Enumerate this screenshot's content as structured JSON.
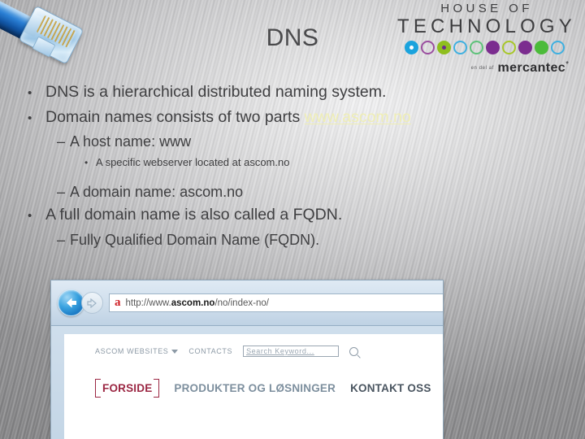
{
  "slide": {
    "title": "DNS",
    "bullets": [
      {
        "level": 1,
        "marker": "•",
        "text": "DNS is a hierarchical distributed naming system."
      },
      {
        "level": 1,
        "marker": "•",
        "text": "Domain names consists of two parts ",
        "link": "www.ascom.no"
      },
      {
        "level": 2,
        "marker": "–",
        "text": "A host name: www"
      },
      {
        "level": 3,
        "marker": "•",
        "text": "A specific webserver located at ascom.no"
      },
      {
        "level": 2,
        "marker": "–",
        "text": "A domain name: ascom.no"
      },
      {
        "level": 1,
        "marker": "•",
        "text": "A full domain name is also called a FQDN."
      },
      {
        "level": 2,
        "marker": "–",
        "text": "Fully Qualified Domain Name (FQDN)."
      }
    ]
  },
  "logo": {
    "line1": "HOUSE OF",
    "line2": "TECHNOLOGY",
    "tagline_prefix": "en del af",
    "tagline_brand": "mercantec",
    "tagline_star": "*",
    "dots": [
      {
        "fill": "#1aa3dd",
        "ring": "#1aa3dd",
        "center": true
      },
      {
        "fill": "none",
        "ring": "#9b4fa0",
        "center": false
      },
      {
        "fill": "#8fbe1f",
        "ring": "#8fbe1f",
        "center": true,
        "inner": "#6b2d8f"
      },
      {
        "fill": "none",
        "ring": "#3fb0e0",
        "center": true,
        "inner": "#8fbe1f"
      },
      {
        "fill": "none",
        "ring": "#5ec27a",
        "center": false
      },
      {
        "fill": "#7b2d8f",
        "ring": "#7b2d8f",
        "center": false
      },
      {
        "fill": "none",
        "ring": "#a8c72a",
        "center": true,
        "inner": "#7b2d8f"
      },
      {
        "fill": "#7b2d8f",
        "ring": "#7b2d8f",
        "center": false
      },
      {
        "fill": "#4cbb3a",
        "ring": "#4cbb3a",
        "center": false
      },
      {
        "fill": "none",
        "ring": "#3fb0e0",
        "center": true,
        "inner": "#d4357f"
      }
    ]
  },
  "browser": {
    "back_icon": "back-arrow-icon",
    "forward_icon": "forward-arrow-icon",
    "favicon_letter": "a",
    "url_prefix": "http://www.",
    "url_bold": "ascom.no",
    "url_suffix": "/no/index-no/",
    "site": {
      "websites_menu": "ASCOM WEBSITES",
      "contacts": "CONTACTS",
      "search_placeholder": "Search Keyword...",
      "nav": [
        {
          "label": "FORSIDE",
          "style": "active"
        },
        {
          "label": "PRODUKTER OG LØSNINGER",
          "style": "gray"
        },
        {
          "label": "KONTAKT OSS",
          "style": "dark"
        }
      ]
    }
  }
}
